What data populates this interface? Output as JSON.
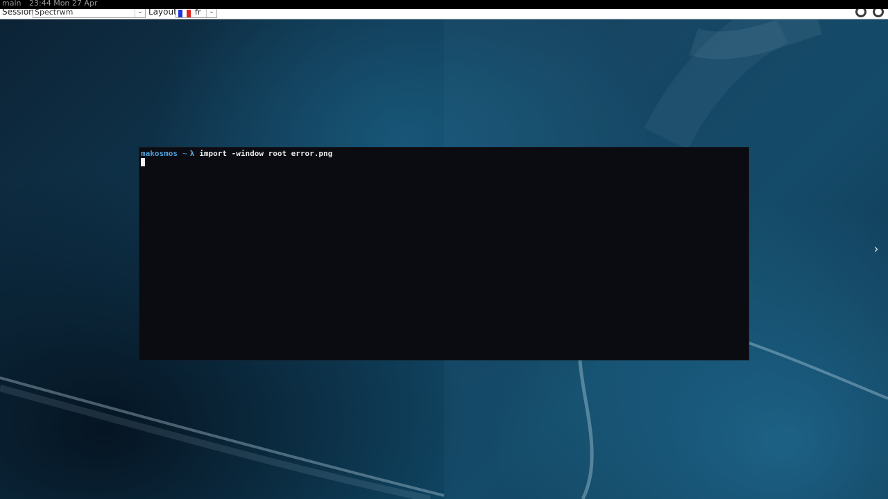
{
  "statusbar": {
    "workspace": "main",
    "datetime": "23:44 Mon 27 Apr"
  },
  "toolbar": {
    "session_label": "Session",
    "session_value": "Spectrwm",
    "layout_label": "Layout",
    "layout_value": "fr"
  },
  "terminal": {
    "prompt_user": "makosmos",
    "prompt_dir": "~",
    "prompt_symbol": "λ",
    "command": "import -window root error.png"
  },
  "icons": {
    "dropdown": "chevron-down-icon",
    "flag": "french-flag-icon",
    "power": "power-icon",
    "next": "chevron-right-icon"
  },
  "colors": {
    "prompt": "#4f9fd8",
    "terminal_bg": "#0b0c12",
    "flag_blue": "#1c35d8",
    "flag_white": "#ffffff",
    "flag_red": "#e0231c"
  }
}
